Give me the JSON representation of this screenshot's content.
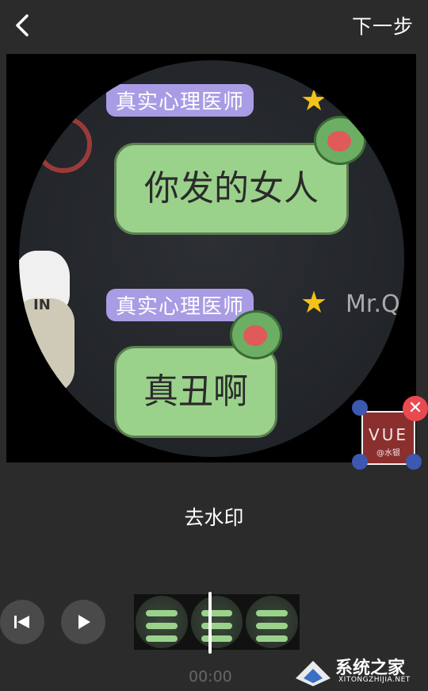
{
  "header": {
    "back_icon": "chevron-left-icon",
    "next_label": "下一步"
  },
  "preview": {
    "labels": [
      "真实心理医师",
      "真实心理医师"
    ],
    "bubbles": [
      "你发的女人",
      "真丑啊"
    ],
    "side_text": "Mr.Qu",
    "badge_text": "IN",
    "watermark": {
      "title": "VUE",
      "subtitle": "@水银"
    }
  },
  "action": {
    "label": "去水印"
  },
  "playback": {
    "prev_icon": "skip-previous-icon",
    "play_icon": "play-icon",
    "time": "00:00"
  },
  "site_logo": {
    "text": "系统之家",
    "url_text": "XITONGZHIJIA.NET"
  },
  "colors": {
    "background": "#2b2b2b",
    "delete": "#e84a4f",
    "handle": "#3d58b0"
  }
}
